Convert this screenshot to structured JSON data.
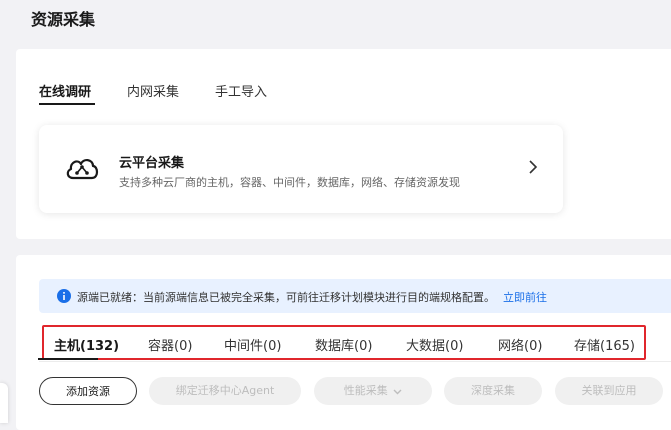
{
  "page": {
    "title": "资源采集"
  },
  "top_tabs": [
    {
      "label": "在线调研",
      "active": true
    },
    {
      "label": "内网采集",
      "active": false
    },
    {
      "label": "手工导入",
      "active": false
    }
  ],
  "cloud_card": {
    "title": "云平台采集",
    "description": "支持多种云厂商的主机，容器、中间件，数据库，网络、存储资源发现",
    "icon": "cloud-share-icon"
  },
  "notice": {
    "text": "源端已就绪：当前源端信息已被完全采集，可前往迁移计划模块进行目的端规格配置。",
    "link": "立即前往",
    "icon": "info-icon"
  },
  "resource_tabs": [
    {
      "label": "主机(132)",
      "active": true
    },
    {
      "label": "容器(0)",
      "active": false
    },
    {
      "label": "中间件(0)",
      "active": false
    },
    {
      "label": "数据库(0)",
      "active": false
    },
    {
      "label": "大数据(0)",
      "active": false
    },
    {
      "label": "网络(0)",
      "active": false
    },
    {
      "label": "存储(165)",
      "active": false
    }
  ],
  "toolbar": {
    "add_resource": "添加资源",
    "bind_agent": "绑定迁移中心Agent",
    "perf_collect": "性能采集",
    "deep_collect": "深度采集",
    "link_app": "关联到应用"
  },
  "colors": {
    "accent_link": "#1a6fe8",
    "highlight_border": "#e0262c",
    "notice_bg": "#e8f1ff"
  }
}
